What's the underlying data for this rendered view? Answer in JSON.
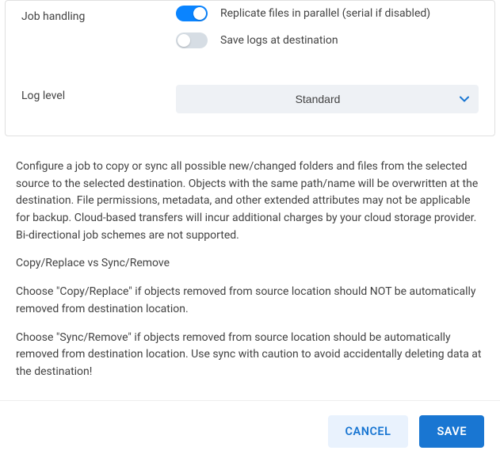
{
  "form": {
    "job_handling": {
      "label": "Job handling",
      "toggles": {
        "parallel": {
          "label": "Replicate files in parallel (serial if disabled)",
          "on": true
        },
        "save_logs": {
          "label": "Save logs at destination",
          "on": false
        }
      }
    },
    "log_level": {
      "label": "Log level",
      "value": "Standard"
    }
  },
  "description": {
    "p1": "Configure a job to copy or sync all possible new/changed folders and files from the selected source to the selected destination. Objects with the same path/name will be overwritten at the destination. File permissions, metadata, and other extended attributes may not be applicable for backup. Cloud-based transfers will incur additional charges by your cloud storage provider. Bi-directional job schemes are not supported.",
    "p2": "Copy/Replace vs Sync/Remove",
    "p3": "Choose \"Copy/Replace\" if objects removed from source location should NOT be automatically removed from destination location.",
    "p4": "Choose \"Sync/Remove\" if objects removed from source location should be automatically removed from destination location. Use sync with caution to avoid accidentally deleting data at the destination!"
  },
  "buttons": {
    "cancel": "CANCEL",
    "save": "SAVE"
  },
  "colors": {
    "accent": "#1976d2",
    "toggle_on": "#0a84ff",
    "toggle_off": "#d6dde4",
    "select_bg": "#eef1f5"
  }
}
